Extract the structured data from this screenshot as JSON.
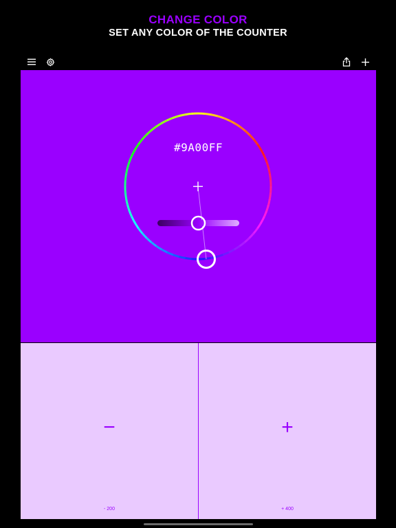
{
  "headline": {
    "line1": "CHANGE COLOR",
    "line2": "SET ANY COLOR OF THE COUNTER"
  },
  "toolbar": {
    "menu_icon": "menu-icon",
    "settings_icon": "gear-icon",
    "share_icon": "share-icon",
    "add_icon": "plus-icon"
  },
  "color_picker": {
    "hex": "#9A00FF",
    "brightness_level": 0.5,
    "center_marker": "+"
  },
  "counter": {
    "decrement_symbol": "−",
    "decrement_count": "- 200",
    "increment_symbol": "+",
    "increment_count": "+ 400"
  },
  "colors": {
    "accent": "#9A00FF",
    "pane_background": "#EACAFF",
    "page_background": "#000000"
  }
}
